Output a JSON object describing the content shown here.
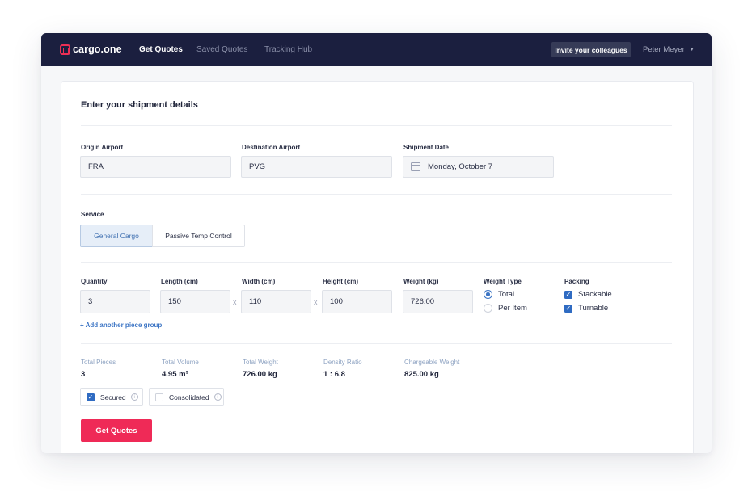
{
  "navbar": {
    "brand": "cargo.one",
    "links": [
      "Get Quotes",
      "Saved Quotes",
      "Tracking Hub"
    ],
    "invite_label": "Invite your colleagues",
    "user_name": "Peter Meyer"
  },
  "form": {
    "title": "Enter your shipment details",
    "origin": {
      "label": "Origin Airport",
      "value": "FRA"
    },
    "destination": {
      "label": "Destination Airport",
      "value": "PVG"
    },
    "date": {
      "label": "Shipment Date",
      "value": "Monday, October 7"
    },
    "service": {
      "label": "Service",
      "options": [
        "General Cargo",
        "Passive Temp Control"
      ],
      "selected": "General Cargo"
    },
    "piece": {
      "quantity": {
        "label": "Quantity",
        "value": "3"
      },
      "length": {
        "label": "Length (cm)",
        "value": "150"
      },
      "width": {
        "label": "Width (cm)",
        "value": "110"
      },
      "height": {
        "label": "Height (cm)",
        "value": "100"
      },
      "weight": {
        "label": "Weight (kg)",
        "value": "726.00"
      },
      "times_symbol": "x"
    },
    "weight_type": {
      "label": "Weight Type",
      "options": [
        "Total",
        "Per Item"
      ],
      "selected": "Total"
    },
    "packing": {
      "label": "Packing",
      "options": [
        "Stackable",
        "Turnable"
      ],
      "checked": [
        true,
        true
      ]
    },
    "add_group_label": "+ Add another piece group",
    "summary": [
      {
        "label": "Total Pieces",
        "value": "3"
      },
      {
        "label": "Total Volume",
        "value": "4.95 m³"
      },
      {
        "label": "Total Weight",
        "value": "726.00 kg"
      },
      {
        "label": "Density Ratio",
        "value": "1 : 6.8"
      },
      {
        "label": "Chargeable Weight",
        "value": "825.00 kg"
      }
    ],
    "options": [
      {
        "label": "Secured",
        "checked": true
      },
      {
        "label": "Consolidated",
        "checked": false
      }
    ],
    "info_glyph": "i",
    "check_glyph": "✓",
    "submit_label": "Get Quotes"
  },
  "colors": {
    "nav_bg": "#1b1f3f",
    "accent": "#ef2a57",
    "link": "#3b74c4"
  },
  "icons": [
    "logo-icon",
    "calendar-icon",
    "chevron-down-icon",
    "info-icon",
    "checkbox-icon",
    "radio-icon"
  ]
}
